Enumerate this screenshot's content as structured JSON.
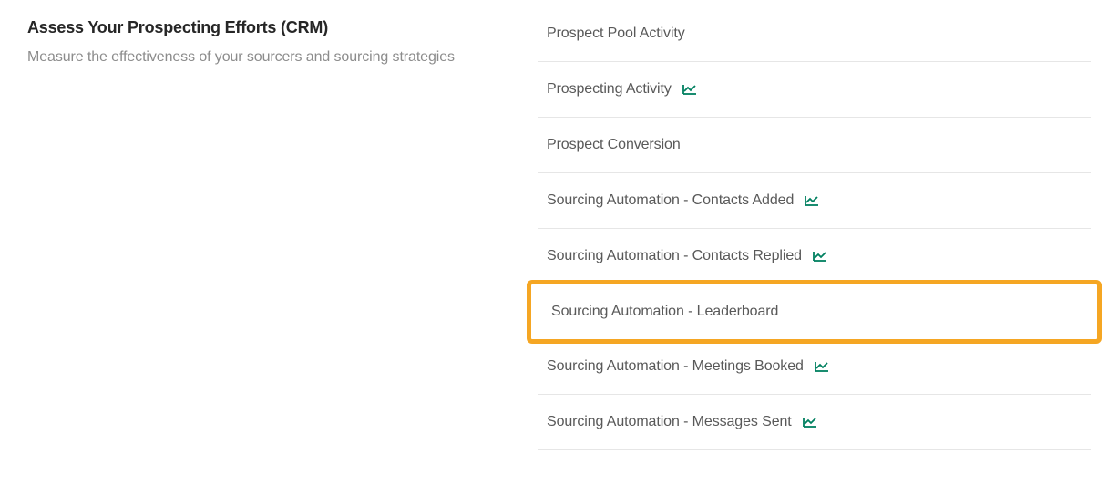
{
  "section": {
    "title": "Assess Your Prospecting Efforts (CRM)",
    "description": "Measure the effectiveness of your sourcers and sourcing strategies"
  },
  "reports": [
    {
      "label": "Prospect Pool Activity",
      "hasChart": false,
      "highlighted": false
    },
    {
      "label": "Prospecting Activity",
      "hasChart": true,
      "highlighted": false
    },
    {
      "label": "Prospect Conversion",
      "hasChart": false,
      "highlighted": false
    },
    {
      "label": "Sourcing Automation - Contacts Added",
      "hasChart": true,
      "highlighted": false
    },
    {
      "label": "Sourcing Automation - Contacts Replied",
      "hasChart": true,
      "highlighted": false
    },
    {
      "label": "Sourcing Automation - Leaderboard",
      "hasChart": false,
      "highlighted": true
    },
    {
      "label": "Sourcing Automation - Meetings Booked",
      "hasChart": true,
      "highlighted": false
    },
    {
      "label": "Sourcing Automation - Messages Sent",
      "hasChart": true,
      "highlighted": false
    }
  ],
  "colors": {
    "chartIcon": "#008060",
    "highlight": "#f5a623"
  }
}
